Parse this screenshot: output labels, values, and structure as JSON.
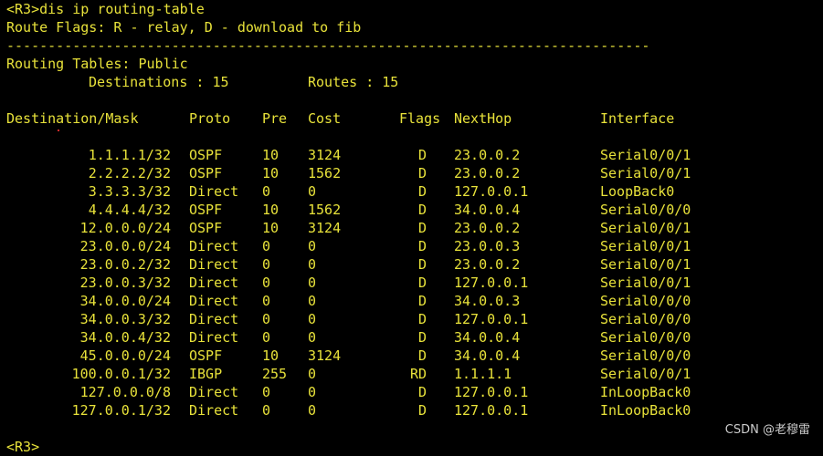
{
  "terminal": {
    "command_prompt": "<R3>dis ip routing-table",
    "route_flags": "Route Flags: R - relay, D - download to fib",
    "separator": "------------------------------------------------------------------------------",
    "routing_tables": "Routing Tables: Public",
    "destinations_label": "Destinations : 15",
    "routes_label": "Routes : 15",
    "headers": {
      "destination_mask": "Destination/Mask",
      "proto": "Proto",
      "pre": "Pre",
      "cost": "Cost",
      "flags": "Flags",
      "nexthop": "NextHop",
      "interface": "Interface"
    },
    "rows": [
      {
        "destination": "1.1.1.1/32",
        "proto": "OSPF",
        "pre": "10",
        "cost": "3124",
        "flags": "D",
        "nexthop": "23.0.0.2",
        "interface": "Serial0/0/1"
      },
      {
        "destination": "2.2.2.2/32",
        "proto": "OSPF",
        "pre": "10",
        "cost": "1562",
        "flags": "D",
        "nexthop": "23.0.0.2",
        "interface": "Serial0/0/1"
      },
      {
        "destination": "3.3.3.3/32",
        "proto": "Direct",
        "pre": "0",
        "cost": "0",
        "flags": "D",
        "nexthop": "127.0.0.1",
        "interface": "LoopBack0"
      },
      {
        "destination": "4.4.4.4/32",
        "proto": "OSPF",
        "pre": "10",
        "cost": "1562",
        "flags": "D",
        "nexthop": "34.0.0.4",
        "interface": "Serial0/0/0"
      },
      {
        "destination": "12.0.0.0/24",
        "proto": "OSPF",
        "pre": "10",
        "cost": "3124",
        "flags": "D",
        "nexthop": "23.0.0.2",
        "interface": "Serial0/0/1"
      },
      {
        "destination": "23.0.0.0/24",
        "proto": "Direct",
        "pre": "0",
        "cost": "0",
        "flags": "D",
        "nexthop": "23.0.0.3",
        "interface": "Serial0/0/1"
      },
      {
        "destination": "23.0.0.2/32",
        "proto": "Direct",
        "pre": "0",
        "cost": "0",
        "flags": "D",
        "nexthop": "23.0.0.2",
        "interface": "Serial0/0/1"
      },
      {
        "destination": "23.0.0.3/32",
        "proto": "Direct",
        "pre": "0",
        "cost": "0",
        "flags": "D",
        "nexthop": "127.0.0.1",
        "interface": "Serial0/0/1"
      },
      {
        "destination": "34.0.0.0/24",
        "proto": "Direct",
        "pre": "0",
        "cost": "0",
        "flags": "D",
        "nexthop": "34.0.0.3",
        "interface": "Serial0/0/0"
      },
      {
        "destination": "34.0.0.3/32",
        "proto": "Direct",
        "pre": "0",
        "cost": "0",
        "flags": "D",
        "nexthop": "127.0.0.1",
        "interface": "Serial0/0/0"
      },
      {
        "destination": "34.0.0.4/32",
        "proto": "Direct",
        "pre": "0",
        "cost": "0",
        "flags": "D",
        "nexthop": "34.0.0.4",
        "interface": "Serial0/0/0"
      },
      {
        "destination": "45.0.0.0/24",
        "proto": "OSPF",
        "pre": "10",
        "cost": "3124",
        "flags": "D",
        "nexthop": "34.0.0.4",
        "interface": "Serial0/0/0"
      },
      {
        "destination": "100.0.0.1/32",
        "proto": "IBGP",
        "pre": "255",
        "cost": "0",
        "flags": "RD",
        "nexthop": "1.1.1.1",
        "interface": "Serial0/0/1"
      },
      {
        "destination": "127.0.0.0/8",
        "proto": "Direct",
        "pre": "0",
        "cost": "0",
        "flags": "D",
        "nexthop": "127.0.0.1",
        "interface": "InLoopBack0"
      },
      {
        "destination": "127.0.0.1/32",
        "proto": "Direct",
        "pre": "0",
        "cost": "0",
        "flags": "D",
        "nexthop": "127.0.0.1",
        "interface": "InLoopBack0"
      }
    ],
    "final_prompt": "<R3>"
  },
  "watermark": "CSDN @老穆雷",
  "colors": {
    "background": "#000000",
    "text": "#e8e23a",
    "watermark": "#d7d7d7"
  }
}
